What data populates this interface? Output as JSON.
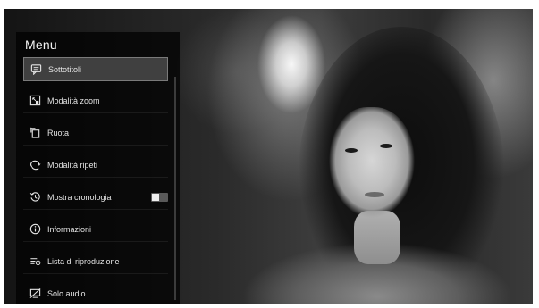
{
  "menu": {
    "title": "Menu",
    "items": [
      {
        "label": "Sottotitoli",
        "icon": "subtitles-icon",
        "selected": true
      },
      {
        "label": "Modalità zoom",
        "icon": "zoom-mode-icon"
      },
      {
        "label": "Ruota",
        "icon": "rotate-icon"
      },
      {
        "label": "Modalità ripeti",
        "icon": "repeat-icon"
      },
      {
        "label": "Mostra cronologia",
        "icon": "history-icon",
        "toggle": "off"
      },
      {
        "label": "Informazioni",
        "icon": "info-icon"
      },
      {
        "label": "Lista di riproduzione",
        "icon": "playlist-icon"
      },
      {
        "label": "Solo audio",
        "icon": "audio-only-icon"
      }
    ]
  },
  "colors": {
    "selected_background": "#404040",
    "panel_background": "#000000",
    "text": "#e4e4e4"
  }
}
